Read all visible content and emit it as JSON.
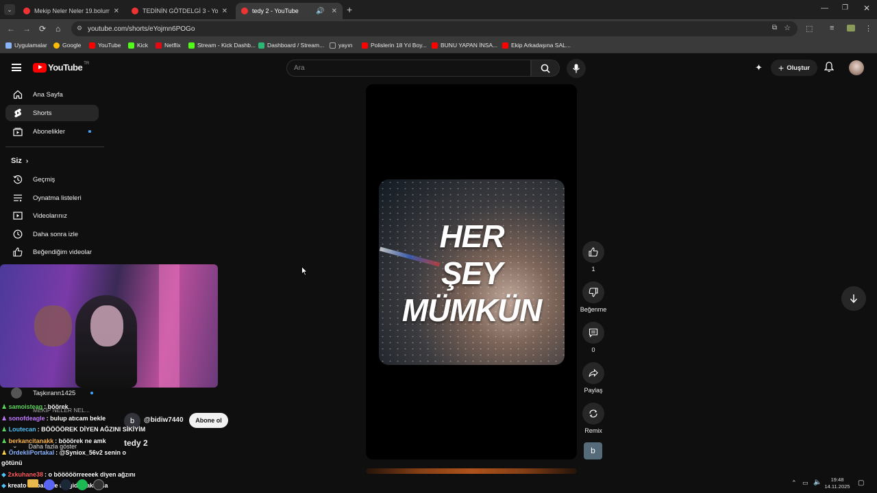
{
  "browser": {
    "tabs": [
      {
        "label": "Mekip Neler Neler 19.bolum - Y"
      },
      {
        "label": "TEDİNİN GÖTDELGİ 3 - YouTub"
      },
      {
        "label": "tedy 2 - YouTube"
      }
    ],
    "url": "youtube.com/shorts/eYojmn6POGo",
    "bookmarks": [
      {
        "label": "Uygulamalar",
        "color": "#8ab4f8"
      },
      {
        "label": "Google",
        "color": "#fbbc05"
      },
      {
        "label": "YouTube",
        "color": "#ff0000"
      },
      {
        "label": "Kick",
        "color": "#53fc18"
      },
      {
        "label": "Netflix",
        "color": "#e50914"
      },
      {
        "label": "Stream - Kick Dashb...",
        "color": "#53fc18"
      },
      {
        "label": "Dashboard / Stream...",
        "color": "#2bb673"
      },
      {
        "label": "yayın",
        "color": "#aaaaaa"
      },
      {
        "label": "Polislerin 18 Yıl Boy...",
        "color": "#ff0000"
      },
      {
        "label": "BUNU YAPAN İNSA...",
        "color": "#ff0000"
      },
      {
        "label": "Ekip Arkadaşına SAL...",
        "color": "#ff0000"
      }
    ]
  },
  "youtube": {
    "logo": "YouTube",
    "region": "TR",
    "search_placeholder": "Ara",
    "create_label": "Oluştur"
  },
  "sidebar": {
    "items": [
      {
        "label": "Ana Sayfa",
        "icon": "home-icon"
      },
      {
        "label": "Shorts",
        "icon": "shorts-icon"
      },
      {
        "label": "Abonelikler",
        "icon": "subscriptions-icon"
      }
    ],
    "you_label": "Siz",
    "you_items": [
      {
        "label": "Geçmiş",
        "icon": "history-icon"
      },
      {
        "label": "Oynatma listeleri",
        "icon": "playlist-icon"
      },
      {
        "label": "Videolarınız",
        "icon": "your-videos-icon"
      },
      {
        "label": "Daha sonra izle",
        "icon": "watch-later-icon"
      },
      {
        "label": "Beğendiğim videolar",
        "icon": "liked-icon"
      }
    ],
    "subs": [
      {
        "label": "Taşkırann1425"
      },
      {
        "label": "MEKİP NELER NEL..."
      },
      {
        "label": "Daha fazla göster"
      }
    ]
  },
  "short": {
    "overlay_lines": [
      "HER",
      "ŞEY",
      "MÜMKÜN"
    ],
    "channel": "@bidiw7440",
    "channel_initial": "b",
    "subscribe_label": "Abone ol",
    "title": "tedy 2"
  },
  "actions": {
    "likes": "1",
    "dislike_label": "Beğenme",
    "comments": "0",
    "share_label": "Paylaş",
    "remix_label": "Remix",
    "avatar_initial": "b"
  },
  "chat": [
    {
      "user": "samoisteag",
      "color": "#5cd65c",
      "text": ": böörek"
    },
    {
      "user": "sonofdeagle",
      "color": "#c27bff",
      "text": ": bulup atıcam bekle"
    },
    {
      "user": "Loutecan",
      "color": "#4fc3f7",
      "text": ": BÖÖÖÖREK DİYEN AĞZINI SİKİYİM"
    },
    {
      "user": "berkancitanakk",
      "color": "#ffb84d",
      "text": ": bööörek ne amk"
    },
    {
      "user": "ÖrdekliPortakal",
      "color": "#8ab4ff",
      "text": ": @Syniox_56v2 senin o"
    },
    {
      "user": "",
      "color": "#ffffff",
      "text": "götünü"
    },
    {
      "user": "2xkuhane38",
      "color": "#ff5c5c",
      "text": ": o bööööörreeeek diyen ağzını"
    },
    {
      "user": "kreato",
      "color": "#ffffff",
      "text": " sabah 5te ne gide yakar ha"
    }
  ],
  "taskbar": {
    "time": "19:48",
    "date": "14.11.2025"
  }
}
